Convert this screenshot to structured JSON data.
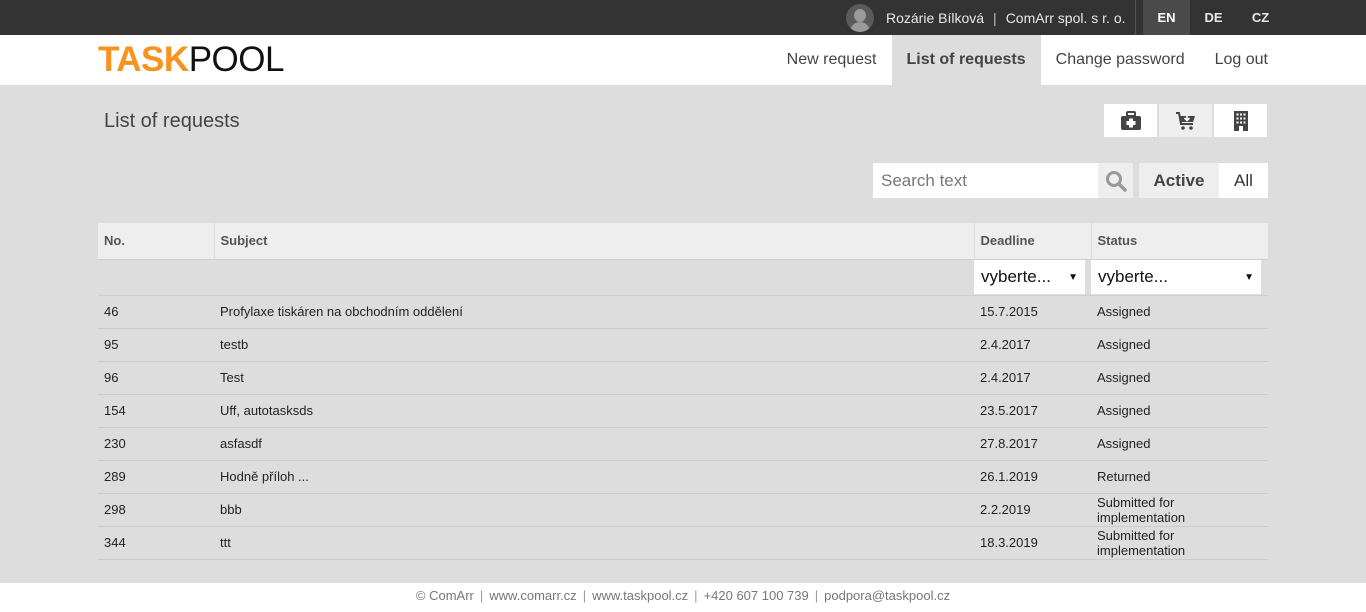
{
  "topbar": {
    "user_name": "Rozárie Bílková",
    "separator": "|",
    "company": "ComArr spol. s r. o.",
    "languages": [
      {
        "label": "EN",
        "active": true
      },
      {
        "label": "DE",
        "active": false
      },
      {
        "label": "CZ",
        "active": false
      }
    ]
  },
  "header": {
    "logo_part1": "TASK",
    "logo_part2": "POOL",
    "nav": [
      {
        "label": "New request",
        "active": false
      },
      {
        "label": "List of requests",
        "active": true
      },
      {
        "label": "Change password",
        "active": false
      },
      {
        "label": "Log out",
        "active": false
      }
    ]
  },
  "page": {
    "title": "List of requests",
    "icon_buttons": [
      "first-aid-kit-icon",
      "cart-download-icon",
      "building-icon"
    ],
    "search": {
      "placeholder": "Search text",
      "value": ""
    },
    "filters": {
      "active_label": "Active",
      "all_label": "All",
      "selected": "Active"
    }
  },
  "table": {
    "columns": [
      "No.",
      "Subject",
      "Deadline",
      "Status"
    ],
    "deadline_filter": "vyberte...",
    "status_filter": "vyberte...",
    "rows": [
      {
        "no": "46",
        "subject": "Profylaxe tiskáren na obchodním oddělení",
        "deadline": "15.7.2015",
        "status": "Assigned"
      },
      {
        "no": "95",
        "subject": "testb",
        "deadline": "2.4.2017",
        "status": "Assigned"
      },
      {
        "no": "96",
        "subject": "Test",
        "deadline": "2.4.2017",
        "status": "Assigned"
      },
      {
        "no": "154",
        "subject": "Uff, autotasksds",
        "deadline": "23.5.2017",
        "status": "Assigned"
      },
      {
        "no": "230",
        "subject": "asfasdf",
        "deadline": "27.8.2017",
        "status": "Assigned"
      },
      {
        "no": "289",
        "subject": "Hodně příloh ...",
        "deadline": "26.1.2019",
        "status": "Returned"
      },
      {
        "no": "298",
        "subject": "bbb",
        "deadline": "2.2.2019",
        "status": "Submitted for implementation"
      },
      {
        "no": "344",
        "subject": "ttt",
        "deadline": "18.3.2019",
        "status": "Submitted for implementation"
      }
    ]
  },
  "footer": {
    "items": [
      "© ComArr",
      "www.comarr.cz",
      "www.taskpool.cz",
      "+420 607 100 739",
      "podpora@taskpool.cz"
    ],
    "separator": "|"
  },
  "colors": {
    "brand_orange": "#f7931e",
    "topbar": "#333333",
    "page_bg": "#dddddd"
  }
}
